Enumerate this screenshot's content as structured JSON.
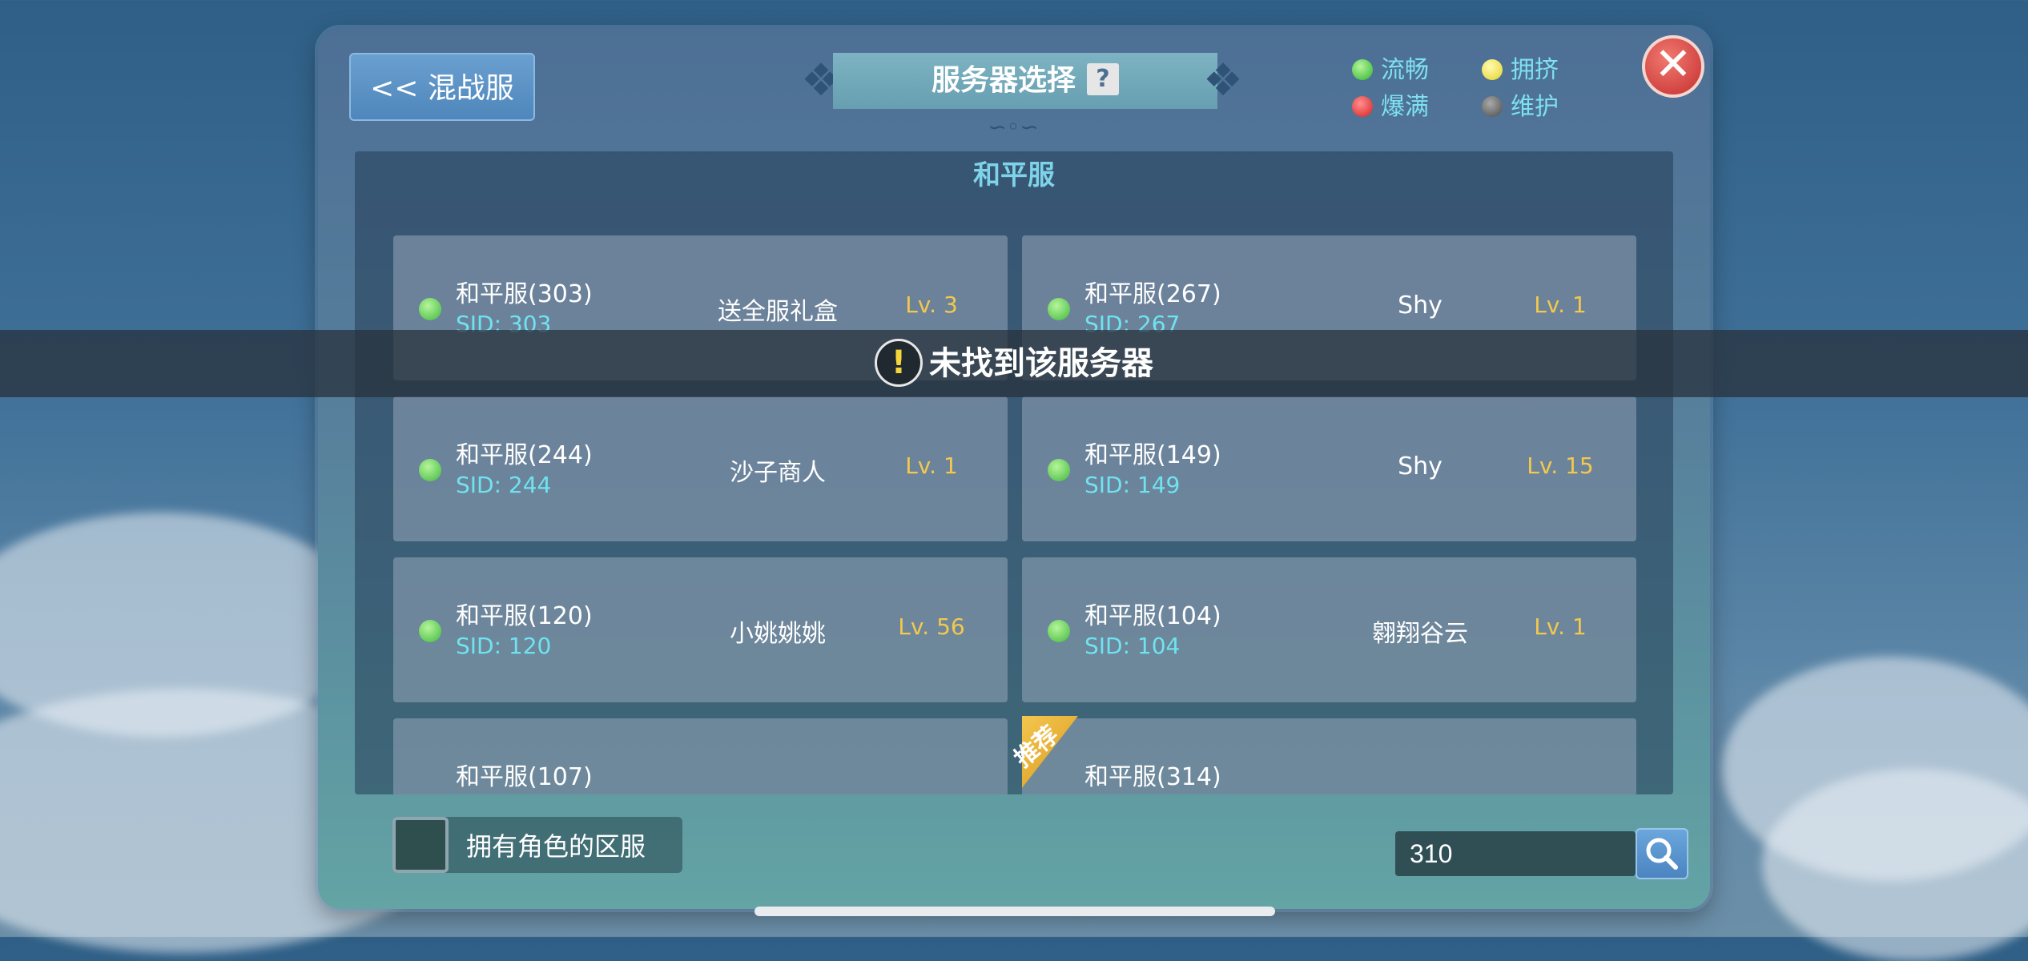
{
  "header": {
    "back_label": "<< 混战服",
    "title": "服务器选择",
    "help_icon": "?",
    "close_icon": "✕"
  },
  "legend": [
    {
      "label": "流畅",
      "color": "#39c739"
    },
    {
      "label": "拥挤",
      "color": "#f2e24a"
    },
    {
      "label": "爆满",
      "color": "#e03030"
    },
    {
      "label": "维护",
      "color": "#5f5f5f"
    }
  ],
  "section": {
    "title": "和平服"
  },
  "servers": [
    {
      "name": "和平服(303)",
      "sid": "SID: 303",
      "role": "送全服礼盒",
      "level": "Lv. 3"
    },
    {
      "name": "和平服(267)",
      "sid": "SID: 267",
      "role": "Shy",
      "level": "Lv. 1"
    },
    {
      "name": "和平服(244)",
      "sid": "SID: 244",
      "role": "沙子商人",
      "level": "Lv. 1"
    },
    {
      "name": "和平服(149)",
      "sid": "SID: 149",
      "role": "Shy",
      "level": "Lv. 15"
    },
    {
      "name": "和平服(120)",
      "sid": "SID: 120",
      "role": "小姚姚姚",
      "level": "Lv. 56"
    },
    {
      "name": "和平服(104)",
      "sid": "SID: 104",
      "role": "翱翔谷云",
      "level": "Lv. 1"
    },
    {
      "name": "和平服(107)",
      "sid": "",
      "role": "",
      "level": ""
    },
    {
      "name": "和平服(314)",
      "sid": "",
      "role": "",
      "level": ""
    }
  ],
  "recommend_tag": "推荐",
  "toast": {
    "icon": "!",
    "message": "未找到该服务器"
  },
  "filter": {
    "label": "拥有角色的区服",
    "checked": false
  },
  "search": {
    "value": "310"
  }
}
